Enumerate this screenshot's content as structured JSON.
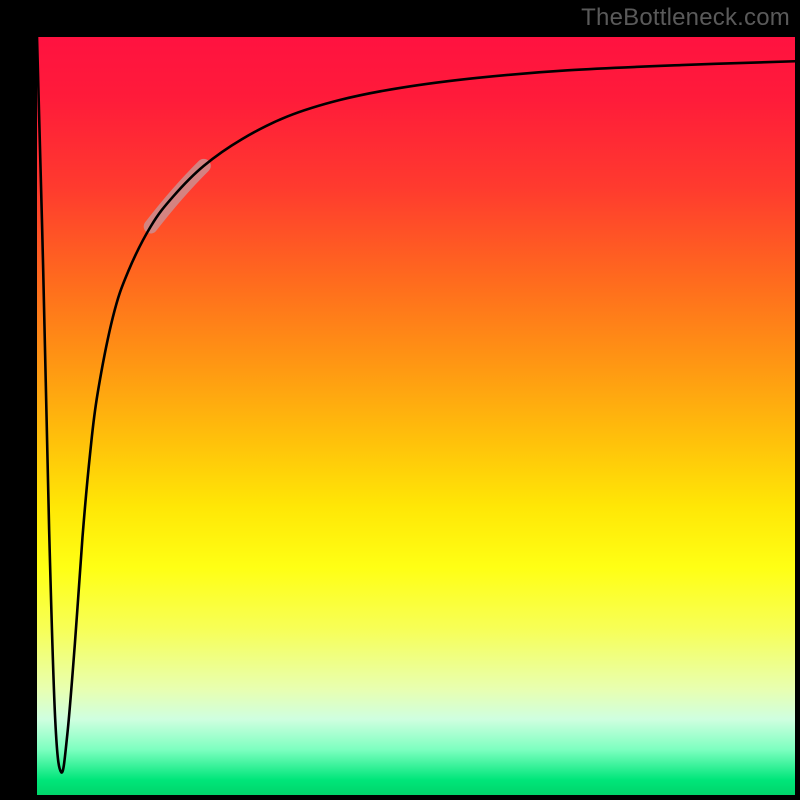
{
  "attribution": "TheBottleneck.com",
  "colors": {
    "page_bg": "#000000",
    "text": "#5a5a5a",
    "curve": "#000000",
    "highlight": "#cf8b8b"
  },
  "chart_data": {
    "type": "line",
    "title": "",
    "xlabel": "",
    "ylabel": "",
    "xlim": [
      0,
      100
    ],
    "ylim": [
      0,
      100
    ],
    "grid": false,
    "legend": false,
    "series": [
      {
        "name": "curve",
        "x": [
          0.0,
          0.8,
          1.6,
          2.4,
          3.2,
          4.0,
          5.0,
          6.0,
          7.0,
          8.0,
          10.0,
          12.0,
          15.0,
          18.0,
          22.0,
          27.0,
          33.0,
          40.0,
          48.0,
          58.0,
          70.0,
          85.0,
          100.0
        ],
        "y": [
          100.0,
          70.0,
          35.0,
          10.0,
          3.0,
          8.0,
          20.0,
          34.0,
          45.0,
          53.0,
          63.0,
          69.0,
          75.0,
          79.0,
          83.0,
          86.5,
          89.5,
          91.7,
          93.3,
          94.6,
          95.6,
          96.3,
          96.8
        ]
      }
    ],
    "highlight": {
      "x": [
        15.0,
        22.0
      ],
      "y": [
        75.0,
        83.0
      ]
    },
    "background_gradient": {
      "direction": "vertical",
      "stops": [
        {
          "pos": 0.0,
          "color": "#ff1240"
        },
        {
          "pos": 0.2,
          "color": "#ff3b2e"
        },
        {
          "pos": 0.44,
          "color": "#ff9a12"
        },
        {
          "pos": 0.7,
          "color": "#ffff14"
        },
        {
          "pos": 0.9,
          "color": "#cfffe0"
        },
        {
          "pos": 1.0,
          "color": "#00d56a"
        }
      ]
    }
  }
}
